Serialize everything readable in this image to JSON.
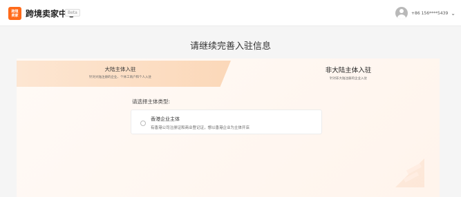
{
  "header": {
    "logo_text": "跨境\n卖家",
    "title": "跨境卖家中心",
    "beta": "Beta",
    "phone": "+86 156****5439"
  },
  "page": {
    "title": "请继续完善入驻信息"
  },
  "tabs": [
    {
      "title": "大陆主体入驻",
      "subtitle": "针对大陆注册的企业、个体工商户和个人入驻"
    },
    {
      "title": "非大陆主体入驻",
      "subtitle": "针对非大陆注册的企业入驻"
    }
  ],
  "form": {
    "label": "请选择主体类型:",
    "options": [
      {
        "title": "香港企业主体",
        "desc": "有香港公司注册证和商业登记证，想以香港企业为主体开店"
      }
    ]
  },
  "colors": {
    "accent": "#ff6a1a",
    "tab_active": "#fbd8b9"
  }
}
